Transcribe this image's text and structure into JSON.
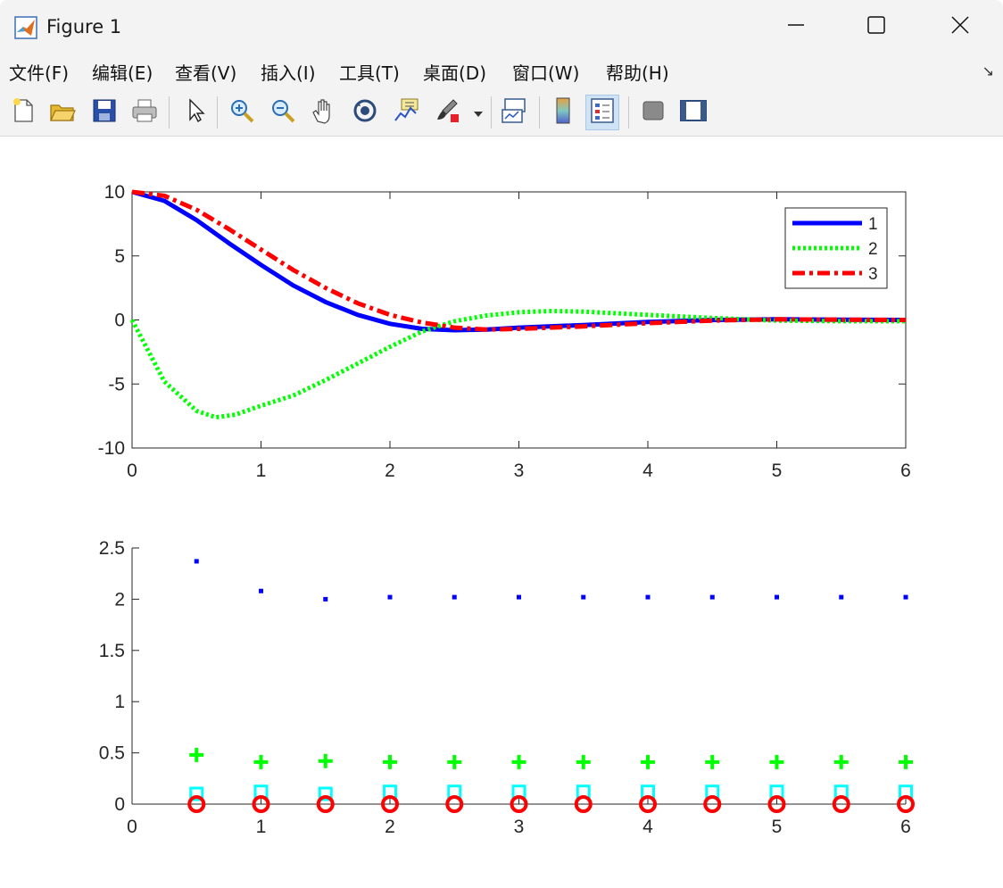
{
  "window": {
    "title": "Figure 1"
  },
  "menu": [
    "文件(F)",
    "编辑(E)",
    "查看(V)",
    "插入(I)",
    "工具(T)",
    "桌面(D)",
    "窗口(W)",
    "帮助(H)"
  ],
  "toolbar": [
    "new-figure-icon",
    "open-file-icon",
    "save-icon",
    "print-icon",
    "select-arrow-icon",
    "zoom-in-icon",
    "zoom-out-icon",
    "pan-hand-icon",
    "rotate-3d-icon",
    "data-cursor-icon",
    "brush-icon",
    "brush-dropdown-icon",
    "link-plot-icon",
    "colorbar-icon",
    "legend-icon",
    "hide-plot-tools-icon",
    "show-plot-tools-icon"
  ],
  "colors": {
    "blue": "#0000ff",
    "green": "#00ff00",
    "red": "#ff0000",
    "cyan": "#00ffff",
    "active_tool": "#cfe3f5"
  },
  "chart_data": [
    {
      "type": "line",
      "x_range": [
        0,
        6
      ],
      "ylim": [
        -10,
        10
      ],
      "x_ticks": [
        "0",
        "1",
        "2",
        "3",
        "4",
        "5",
        "6"
      ],
      "y_ticks": [
        "10",
        "5",
        "0",
        "-5",
        "-10"
      ],
      "grid": false,
      "legend_position": "top-right",
      "series": [
        {
          "name": "1",
          "style": "solid",
          "color": "#0000ff",
          "x": [
            0,
            0.25,
            0.5,
            0.75,
            1,
            1.25,
            1.5,
            1.75,
            2,
            2.25,
            2.5,
            2.75,
            3,
            3.5,
            4,
            4.5,
            5,
            5.5,
            6
          ],
          "y": [
            10,
            9.3,
            7.8,
            6,
            4.3,
            2.7,
            1.4,
            0.4,
            -0.3,
            -0.7,
            -0.8,
            -0.75,
            -0.6,
            -0.4,
            -0.15,
            0,
            0.05,
            0.02,
            0
          ]
        },
        {
          "name": "2",
          "style": "dotted",
          "color": "#00ff00",
          "x": [
            0,
            0.25,
            0.5,
            0.65,
            0.8,
            1,
            1.25,
            1.5,
            1.75,
            2,
            2.25,
            2.5,
            2.75,
            3,
            3.25,
            3.5,
            4,
            4.5,
            5,
            5.5,
            6
          ],
          "y": [
            0,
            -4.8,
            -7.1,
            -7.6,
            -7.4,
            -6.7,
            -5.9,
            -4.7,
            -3.4,
            -2.1,
            -0.9,
            -0.1,
            0.35,
            0.6,
            0.7,
            0.65,
            0.4,
            0.15,
            -0.05,
            -0.1,
            -0.1
          ]
        },
        {
          "name": "3",
          "style": "dashdot",
          "color": "#ff0000",
          "x": [
            0,
            0.25,
            0.5,
            0.75,
            1,
            1.25,
            1.5,
            1.75,
            2,
            2.25,
            2.5,
            2.75,
            3,
            3.5,
            4,
            4.5,
            5,
            5.5,
            6
          ],
          "y": [
            10,
            9.7,
            8.6,
            7.1,
            5.5,
            3.9,
            2.5,
            1.3,
            0.4,
            -0.2,
            -0.6,
            -0.75,
            -0.7,
            -0.5,
            -0.25,
            -0.05,
            0.05,
            0.02,
            0
          ]
        }
      ]
    },
    {
      "type": "scatter",
      "x_range": [
        0,
        6
      ],
      "ylim": [
        0,
        2.5
      ],
      "x_ticks": [
        "0",
        "1",
        "2",
        "3",
        "4",
        "5",
        "6"
      ],
      "y_ticks": [
        "2.5",
        "2",
        "1.5",
        "1",
        "0.5",
        "0"
      ],
      "grid": false,
      "series": [
        {
          "marker": "point",
          "color": "#0000ff",
          "x": [
            0.5,
            1,
            1.5,
            2,
            2.5,
            3,
            3.5,
            4,
            4.5,
            5,
            5.5,
            6
          ],
          "y": [
            2.37,
            2.08,
            2.0,
            2.02,
            2.02,
            2.02,
            2.02,
            2.02,
            2.02,
            2.02,
            2.02,
            2.02
          ]
        },
        {
          "marker": "plus",
          "color": "#00ff00",
          "x": [
            0.5,
            1,
            1.5,
            2,
            2.5,
            3,
            3.5,
            4,
            4.5,
            5,
            5.5,
            6
          ],
          "y": [
            0.48,
            0.41,
            0.42,
            0.41,
            0.41,
            0.41,
            0.41,
            0.41,
            0.41,
            0.41,
            0.41,
            0.41
          ]
        },
        {
          "marker": "square",
          "color": "#00ffff",
          "x": [
            0.5,
            1,
            1.5,
            2,
            2.5,
            3,
            3.5,
            4,
            4.5,
            5,
            5.5,
            6
          ],
          "y": [
            0.1,
            0.12,
            0.1,
            0.12,
            0.12,
            0.12,
            0.12,
            0.12,
            0.12,
            0.12,
            0.12,
            0.12
          ]
        },
        {
          "marker": "circle",
          "color": "#ff0000",
          "x": [
            0.5,
            1,
            1.5,
            2,
            2.5,
            3,
            3.5,
            4,
            4.5,
            5,
            5.5,
            6
          ],
          "y": [
            0,
            0,
            0,
            0,
            0,
            0,
            0,
            0,
            0,
            0,
            0,
            0
          ]
        }
      ]
    }
  ]
}
